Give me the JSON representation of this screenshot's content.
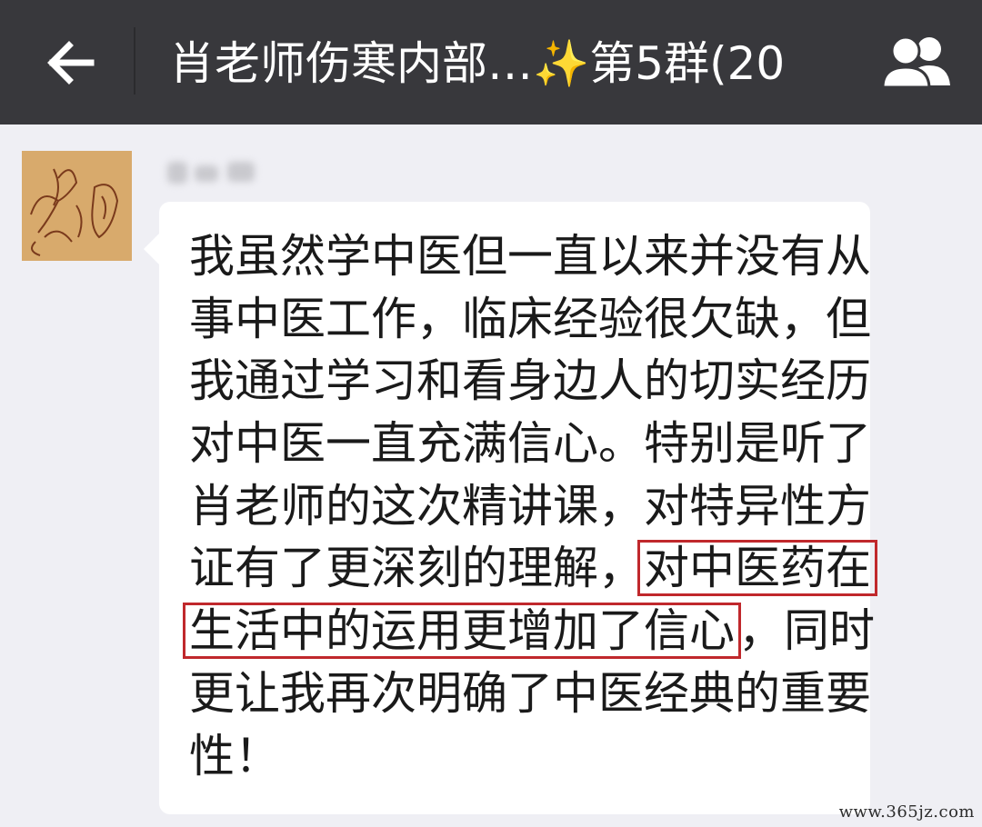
{
  "header": {
    "back_icon": "arrow-left-icon",
    "title_prefix": "肖老师伤寒内部…",
    "title_sparkle": "✨",
    "title_suffix": "第5群(20",
    "members_icon": "group-members-icon",
    "background": "#38383c"
  },
  "message": {
    "sender_name_blurred": true,
    "avatar": "hand-drawn-sketch-avatar",
    "lines": [
      {
        "text": "我虽然学中医但一直以来并没有从"
      },
      {
        "text": "事中医工作，临床经验很欠缺，但"
      },
      {
        "text": "我通过学习和看身边人的切实经历"
      },
      {
        "text": "对中医一直充满信心。特别是听了"
      },
      {
        "text": "肖老师的这次精讲课，对特异性方"
      },
      {
        "text_before": "证有了更深刻的理解，",
        "highlight": "对中医药在"
      },
      {
        "highlight": "生活中的运用更增加了信心",
        "text_after": "，同时"
      },
      {
        "text": "更让我再次明确了中医经典的重要"
      },
      {
        "text": "性！"
      }
    ],
    "highlight_color": "#c0282c"
  },
  "watermark": "www.365jz.com"
}
